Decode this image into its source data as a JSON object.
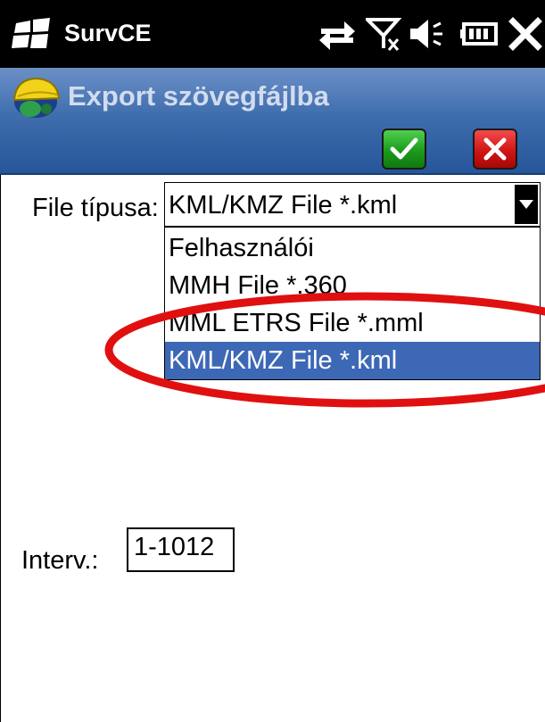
{
  "statusbar": {
    "app_name": "SurvCE",
    "icons": [
      "windows-logo-icon",
      "connectivity-arrows-icon",
      "no-signal-icon",
      "speaker-icon",
      "battery-icon",
      "close-icon"
    ]
  },
  "header": {
    "title": "Export szövegfájlba",
    "icon": "helmet-icon",
    "ok_icon": "checkmark-icon",
    "cancel_icon": "x-icon",
    "colors": {
      "ok": "#1d9a1d",
      "cancel": "#d31414",
      "header": "#3f6dad"
    }
  },
  "form": {
    "file_type_label": "File típusa:",
    "file_type_value": "KML/KMZ File *.kml",
    "options": [
      "Felhasználói",
      "MMH File *.360",
      "MML ETRS File *.mml",
      "KML/KMZ File *.kml"
    ],
    "selected_option": "KML/KMZ File *.kml",
    "interval_label": "Interv.:",
    "interval_value": "1-1012"
  },
  "annotation": {
    "shape": "ellipse",
    "color": "#e01010"
  }
}
